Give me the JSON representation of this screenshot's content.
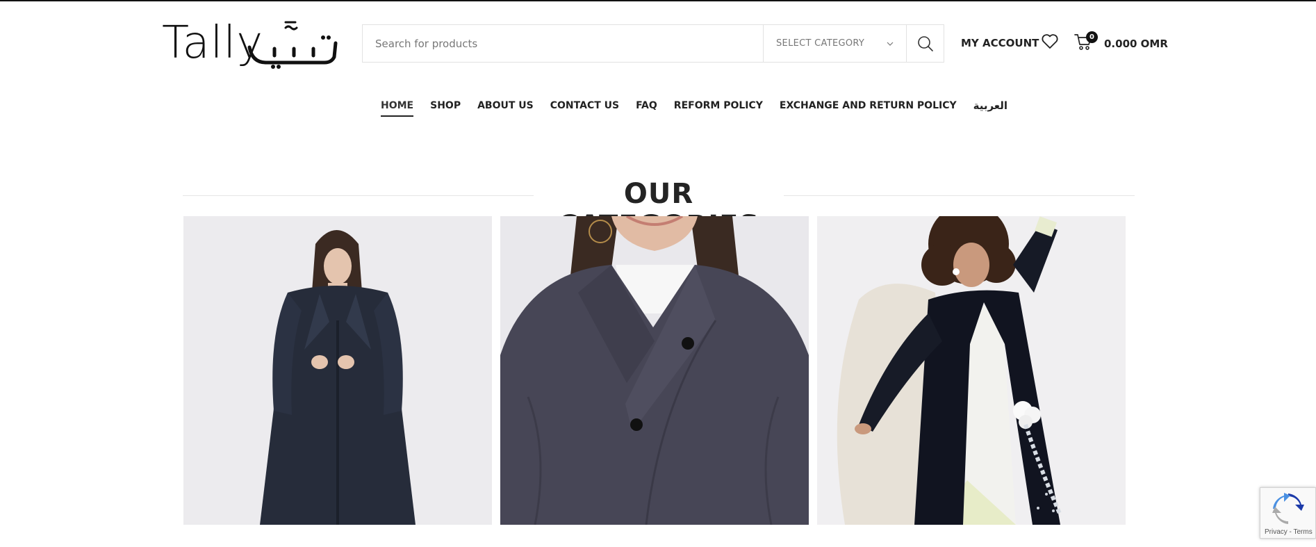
{
  "brand": {
    "logo_text_latin": "Tally",
    "logo_text_arabic": "تلّي"
  },
  "search": {
    "placeholder": "Search for products",
    "category_label": "SELECT CATEGORY"
  },
  "header": {
    "account_label": "MY ACCOUNT",
    "cart_count": "0",
    "cart_total": "0.000 OMR"
  },
  "nav": {
    "items": [
      {
        "label": "HOME",
        "active": true
      },
      {
        "label": "SHOP"
      },
      {
        "label": "ABOUT US"
      },
      {
        "label": "CONTACT US"
      },
      {
        "label": "FAQ"
      },
      {
        "label": "REFORM POLICY"
      },
      {
        "label": "EXCHANGE AND RETURN POLICY"
      },
      {
        "label": "العربية"
      }
    ]
  },
  "categories": {
    "title": "OUR CATEGORIES"
  },
  "recaptcha": {
    "links": "Privacy - Terms"
  },
  "colors": {
    "text": "#1b1b1b",
    "border": "#e2e2e2",
    "garment_navy": "#2a3142",
    "garment_charcoal": "#474656",
    "background_studio": "#ecebee"
  }
}
